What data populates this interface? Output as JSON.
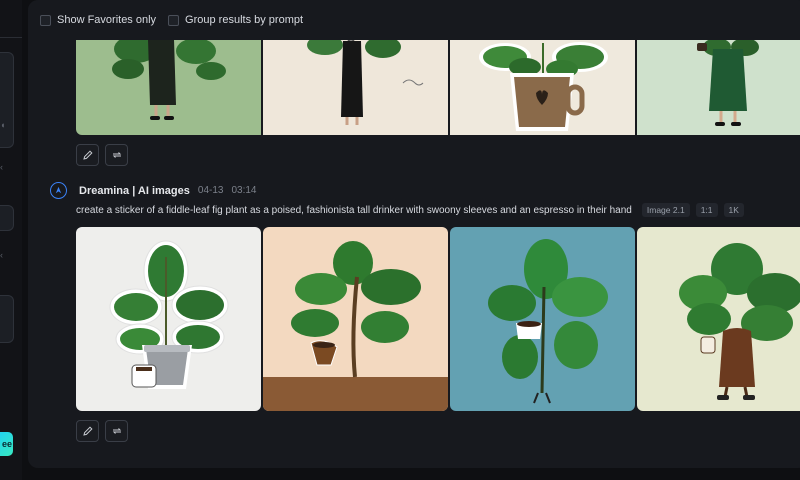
{
  "filters": {
    "favorites_label": "Show Favorites only",
    "group_label": "Group results by prompt"
  },
  "sidebar": {
    "cta_label": "ee"
  },
  "generation": {
    "author": "Dreamina | AI images",
    "date": "04-13",
    "time": "03:14",
    "prompt": "create a sticker of a fiddle-leaf fig plant as a poised, fashionista tall drinker with swoony sleeves and an espresso in their hand",
    "tags": [
      "Image 2.1",
      "1:1",
      "1K"
    ]
  },
  "icons": {
    "edit": "edit-icon",
    "regenerate": "regenerate-icon",
    "logo": "dreamina-logo-icon"
  }
}
